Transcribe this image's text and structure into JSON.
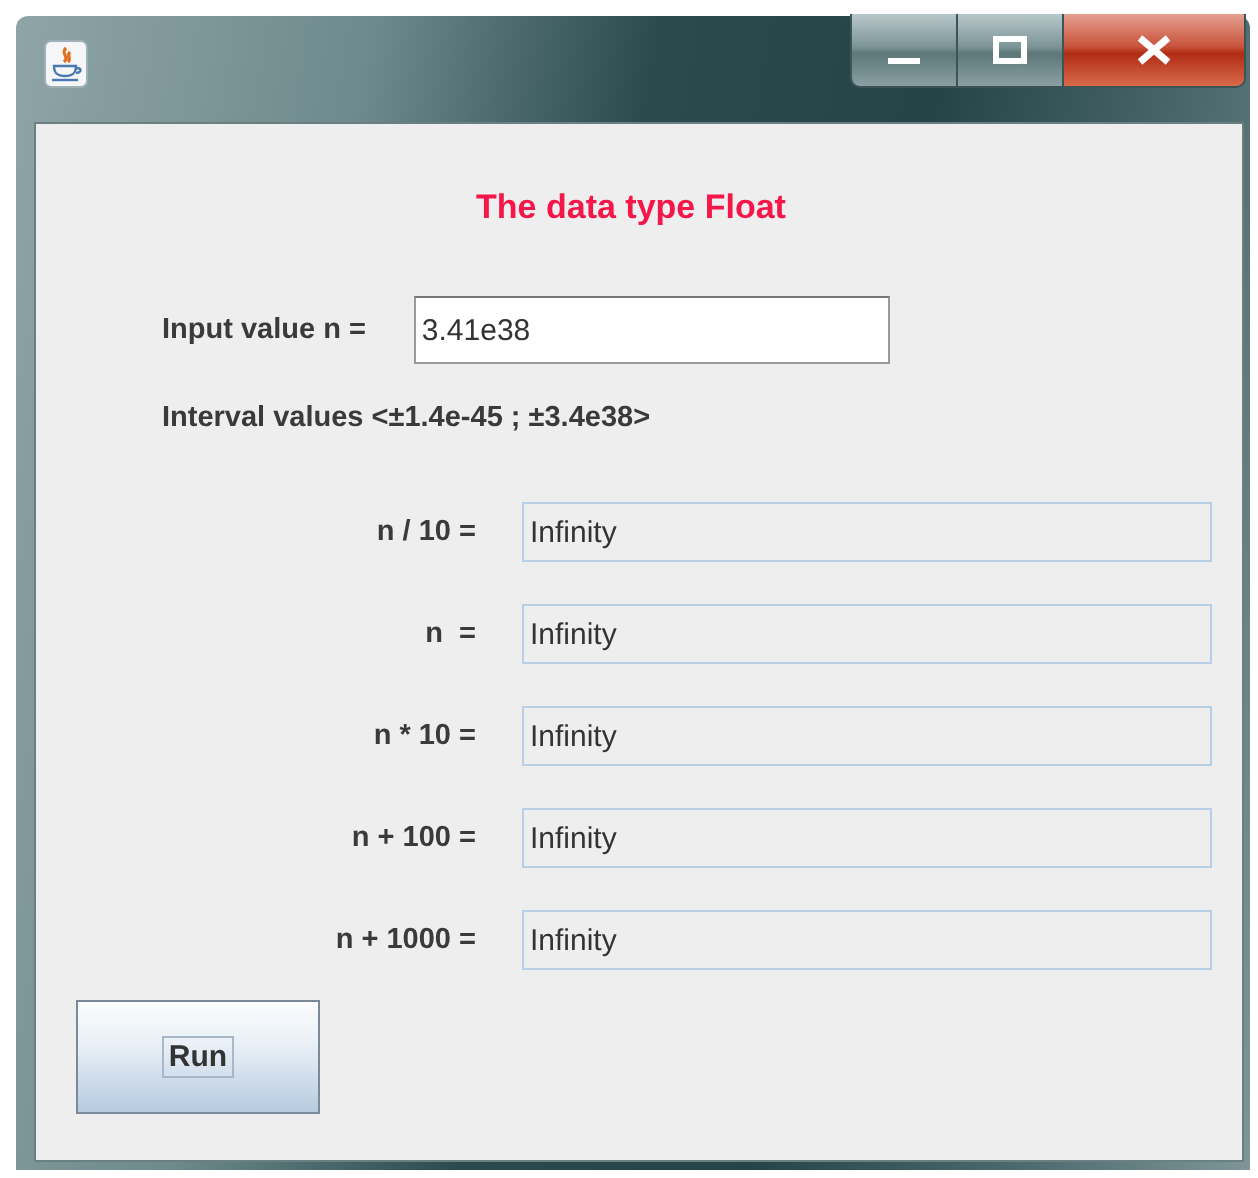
{
  "window": {
    "title_buttons": [
      {
        "kind": "minimize"
      },
      {
        "kind": "maximize"
      },
      {
        "kind": "close"
      }
    ]
  },
  "heading": "The data type Float",
  "input": {
    "label": "Input value n =",
    "value": "3.41e38"
  },
  "interval": "Interval values <±1.4e-45 ; ±3.4e38>",
  "results": [
    {
      "label": "n / 10 =",
      "value": "Infinity"
    },
    {
      "label": "n  =",
      "value": "Infinity"
    },
    {
      "label": "n * 10 =",
      "value": "Infinity"
    },
    {
      "label": "n + 100 =",
      "value": "Infinity"
    },
    {
      "label": "n + 1000 =",
      "value": "Infinity"
    }
  ],
  "run_button": {
    "label": "Run",
    "focused": true
  }
}
